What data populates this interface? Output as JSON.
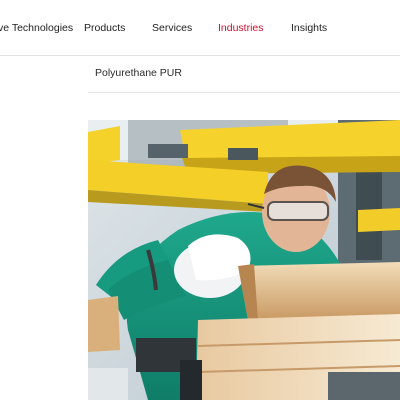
{
  "nav": {
    "items": [
      {
        "label": "ve Technologies",
        "active": false
      },
      {
        "label": "Products",
        "active": false
      },
      {
        "label": "Services",
        "active": false
      },
      {
        "label": "Industries",
        "active": true
      },
      {
        "label": "Insights",
        "active": false
      }
    ]
  },
  "page": {
    "title": "Polyurethane PUR"
  },
  "colors": {
    "accent": "#c8102e",
    "text": "#1e1e1e",
    "divider": "#e2e2e2"
  }
}
